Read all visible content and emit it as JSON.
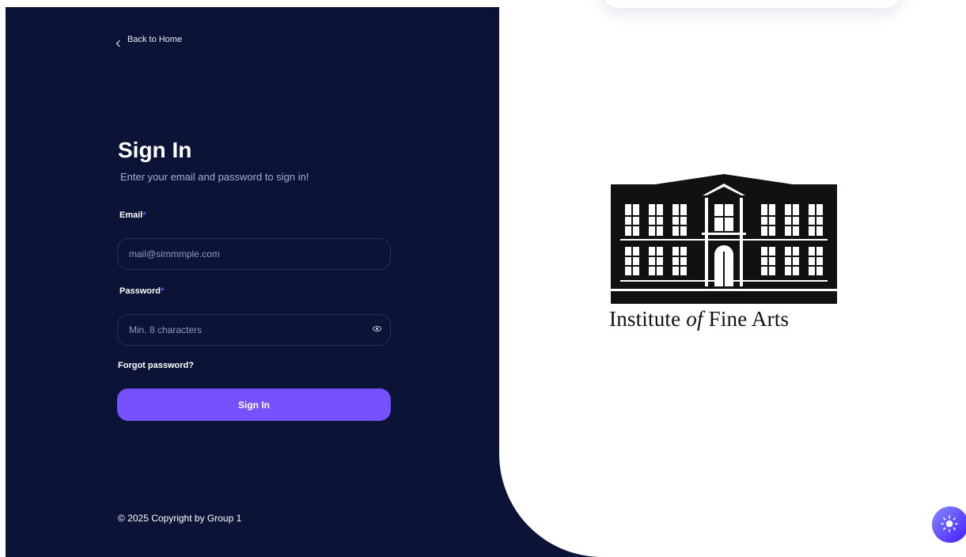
{
  "nav": {
    "back_label": "Back to Home"
  },
  "form": {
    "title": "Sign In",
    "subtitle": "Enter your email and password to sign in!",
    "email_label": "Email",
    "required_mark": "*",
    "email_placeholder": "mail@simmmple.com",
    "password_label": "Password",
    "password_placeholder": "Min. 8 characters",
    "forgot_label": "Forgot password?",
    "submit_label": "Sign In"
  },
  "footer": {
    "copyright": "© 2025 Copyright by Group 1"
  },
  "brand": {
    "logo_text": "Institute of Fine Arts",
    "logo_name": "building-logo"
  },
  "colors": {
    "panel": "#0b1437",
    "accent": "#7551ff",
    "subtitle": "#a3aed0",
    "toggle_start": "#868cff",
    "toggle_end": "#4318ff"
  },
  "icons": {
    "back": "chevron-left-icon",
    "password_toggle": "eye-icon",
    "theme": "sun-icon"
  }
}
